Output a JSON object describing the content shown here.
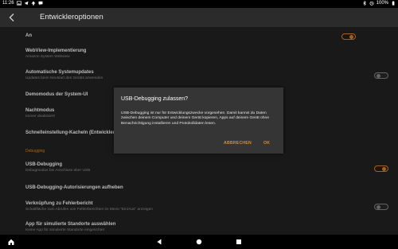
{
  "status_bar": {
    "time": "11:26",
    "battery": "100%"
  },
  "app_bar": {
    "title": "Entwickleroptionen"
  },
  "settings": {
    "master_label": "An",
    "webview_label": "WebView-Implementierung",
    "webview_sub": "Amazon System Webview",
    "autoupdate_label": "Automatische Systemupdates",
    "autoupdate_sub": "Updates beim Neustart des Geräts anwenden",
    "demo_label": "Demomodus der System-UI",
    "night_label": "Nachtmodus",
    "night_sub": "Immer deaktiviert",
    "quicktiles_label": "Schnelleinstellung-Kacheln (Entwickler)",
    "section_debugging": "Debugging",
    "usb_debug_label": "USB-Debugging",
    "usb_debug_sub": "Debugmodus bei Anschluss über USB",
    "revoke_label": "USB-Debugging-Autorisierungen aufheben",
    "bugreport_label": "Verknüpfung zu Fehlerbericht",
    "bugreport_sub": "Schaltfläche zum Abrufen von Fehlerberichten im Menü \"Ein/Aus\" anzeigen",
    "mock_location_label": "App für simulierte Standorte auswählen",
    "mock_location_sub": "Keine App für simulierte Standorte eingerichtet"
  },
  "toggles": {
    "master": true,
    "autoupdate": false,
    "usb_debug": true,
    "bugreport": false
  },
  "dialog": {
    "title": "USB-Debugging zulassen?",
    "body": "USB-Debugging ist nur für Entwicklungszwecke vorgesehen. Damit kannst du Daten zwischen deinem Computer und deinem Gerät kopieren, Apps auf deinem Gerät ohne Benachrichtigung installieren und Protokolldaten lesen.",
    "cancel_label": "ABBRECHEN",
    "ok_label": "OK"
  },
  "colors": {
    "accent": "#e0882a",
    "list_bg": "#232323",
    "appbar_bg": "#2b2b2b",
    "dialog_bg": "#353535"
  },
  "icons": {
    "status_left": [
      "image-icon",
      "telegram-icon",
      "arrow-up-icon",
      "message-icon"
    ],
    "status_right": [
      "bluetooth-icon",
      "alarm-icon",
      "battery-icon"
    ],
    "nav": [
      "home-icon",
      "back-icon",
      "circle-home-icon",
      "square-recents-icon"
    ]
  }
}
